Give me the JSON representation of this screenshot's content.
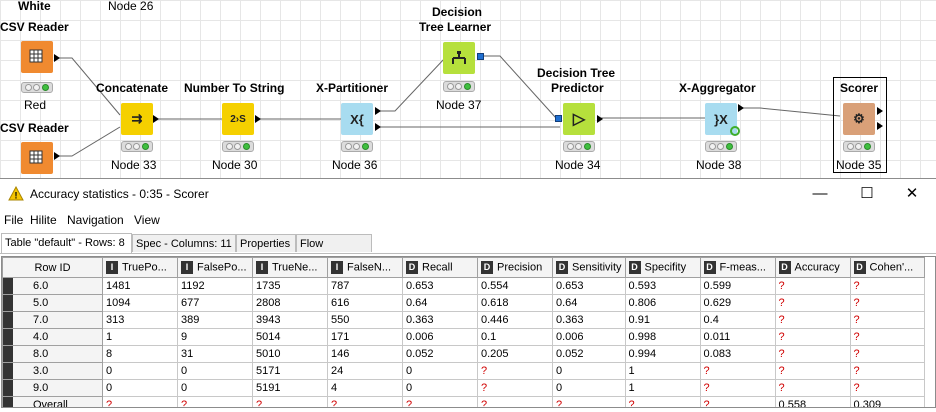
{
  "workflow": {
    "header_left": "White",
    "header_node": "Node 26",
    "nodes": {
      "csv1": {
        "label": "CSV Reader",
        "icon": "csv-reader-icon",
        "color": "#f08a30"
      },
      "csv2": {
        "label": "CSV Reader",
        "icon": "csv-reader-icon",
        "color": "#f08a30"
      },
      "red_label": "Red",
      "concat": {
        "label": "Concatenate",
        "id": "Node 33",
        "color": "#f5d000",
        "glyph": "⇉"
      },
      "nts": {
        "label": "Number To String",
        "id": "Node 30",
        "color": "#f5d000",
        "glyph": "2›S"
      },
      "xpart": {
        "label": "X-Partitioner",
        "id": "Node 36",
        "color": "#a8dcf0",
        "glyph": "X{"
      },
      "dtl": {
        "label1": "Decision",
        "label2": "Tree Learner",
        "id": "Node 37",
        "color": "#b6e03c",
        "glyph": "⯅"
      },
      "dtp": {
        "label1": "Decision Tree",
        "label2": "Predictor",
        "id": "Node 34",
        "color": "#b6e03c",
        "glyph": "▷"
      },
      "xagg": {
        "label": "X-Aggregator",
        "id": "Node 38",
        "color": "#a8dcf0",
        "glyph": "}X"
      },
      "scorer": {
        "label": "Scorer",
        "id": "Node 35",
        "color": "#d9a078",
        "glyph": "⚙"
      }
    }
  },
  "dialog": {
    "title": "Accuracy statistics - 0:35 - Scorer",
    "warning_icon": "warning-triangle-icon",
    "controls": {
      "minimize": "—",
      "maximize": "☐",
      "close": "✕"
    },
    "menu": [
      "File",
      "Hilite",
      "Navigation",
      "View"
    ],
    "tabs": [
      "Table \"default\" - Rows: 8",
      "Spec - Columns: 11",
      "Properties",
      "Flow Variables"
    ],
    "table": {
      "columns": [
        {
          "label": "Row ID",
          "type": ""
        },
        {
          "label": "TruePo...",
          "type": "I"
        },
        {
          "label": "FalsePo...",
          "type": "I"
        },
        {
          "label": "TrueNe...",
          "type": "I"
        },
        {
          "label": "FalseN...",
          "type": "I"
        },
        {
          "label": "Recall",
          "type": "D"
        },
        {
          "label": "Precision",
          "type": "D"
        },
        {
          "label": "Sensitivity",
          "type": "D"
        },
        {
          "label": "Specifity",
          "type": "D"
        },
        {
          "label": "F-meas...",
          "type": "D"
        },
        {
          "label": "Accuracy",
          "type": "D"
        },
        {
          "label": "Cohen'...",
          "type": "D"
        }
      ],
      "rows": [
        [
          "6.0",
          "1481",
          "1192",
          "1735",
          "787",
          "0.653",
          "0.554",
          "0.653",
          "0.593",
          "0.599",
          "?",
          "?"
        ],
        [
          "5.0",
          "1094",
          "677",
          "2808",
          "616",
          "0.64",
          "0.618",
          "0.64",
          "0.806",
          "0.629",
          "?",
          "?"
        ],
        [
          "7.0",
          "313",
          "389",
          "3943",
          "550",
          "0.363",
          "0.446",
          "0.363",
          "0.91",
          "0.4",
          "?",
          "?"
        ],
        [
          "4.0",
          "1",
          "9",
          "5014",
          "171",
          "0.006",
          "0.1",
          "0.006",
          "0.998",
          "0.011",
          "?",
          "?"
        ],
        [
          "8.0",
          "8",
          "31",
          "5010",
          "146",
          "0.052",
          "0.205",
          "0.052",
          "0.994",
          "0.083",
          "?",
          "?"
        ],
        [
          "3.0",
          "0",
          "0",
          "5171",
          "24",
          "0",
          "?",
          "0",
          "1",
          "?",
          "?",
          "?"
        ],
        [
          "9.0",
          "0",
          "0",
          "5191",
          "4",
          "0",
          "?",
          "0",
          "1",
          "?",
          "?",
          "?"
        ],
        [
          "Overall",
          "?",
          "?",
          "?",
          "?",
          "?",
          "?",
          "?",
          "?",
          "?",
          "0.558",
          "0.309"
        ]
      ]
    }
  }
}
